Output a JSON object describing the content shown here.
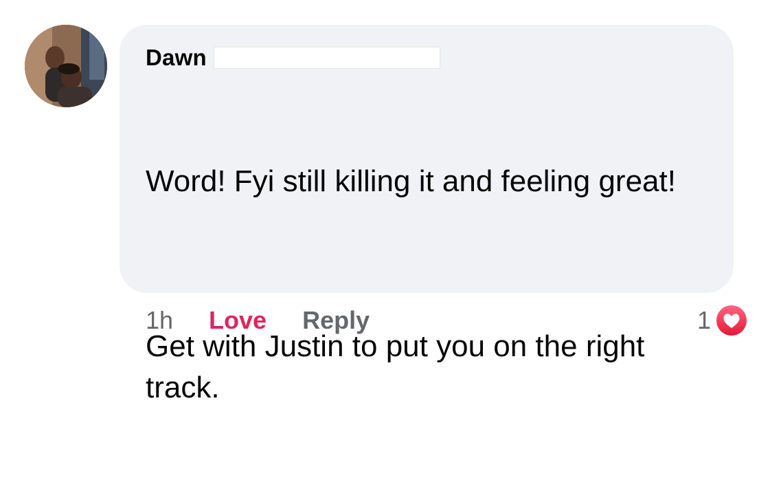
{
  "comment": {
    "author": "Dawn",
    "paragraphs": [
      "Word! Fyi still killing it and feeling great!",
      "Get with Justin to put you on the right track."
    ]
  },
  "actions": {
    "timestamp": "1h",
    "love_label": "Love",
    "reply_label": "Reply"
  },
  "reactions": {
    "count": "1",
    "icon": "love-reaction-icon",
    "color": "#f33e58"
  },
  "colors": {
    "bubble": "#f0f2f5",
    "love_text": "#e0245e",
    "muted_text": "#65676b"
  }
}
